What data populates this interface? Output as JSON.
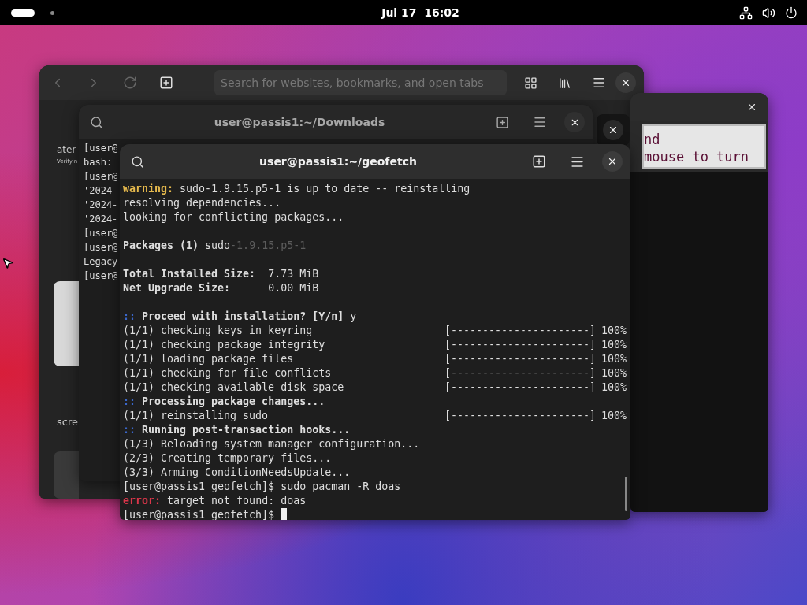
{
  "top_bar": {
    "clock": "Jul 17  16:02"
  },
  "browser": {
    "search": {
      "placeholder": "Search for websites, bookmarks, and open tabs"
    },
    "sidebar_texts": [
      "ater",
      "Verifyin",
      "scre"
    ]
  },
  "game_window": {
    "lines": [
      "nd",
      "mouse to turn"
    ]
  },
  "back_terminal": {
    "title": "user@passis1:~/Downloads",
    "lines": [
      "[user@",
      "bash:",
      "[user@",
      "'2024-",
      "'2024-",
      "'2024-",
      "[user@",
      "[user@",
      "Legacy",
      "[user@"
    ]
  },
  "front_terminal": {
    "title": "user@passis1:~/geofetch",
    "lines": [
      {
        "kind": "text",
        "segments": [
          {
            "text": "warning:",
            "kind": "warning"
          },
          {
            "text": " sudo-1.9.15.p5-1 is up to date -- reinstalling",
            "kind": "plain"
          }
        ]
      },
      {
        "kind": "text",
        "segments": [
          {
            "text": "resolving dependencies...",
            "kind": "plain"
          }
        ]
      },
      {
        "kind": "text",
        "segments": [
          {
            "text": "looking for conflicting packages...",
            "kind": "plain"
          }
        ]
      },
      {
        "kind": "blank"
      },
      {
        "kind": "text",
        "segments": [
          {
            "text": "Packages (1)",
            "kind": "bold"
          },
          {
            "text": " sudo",
            "kind": "plain"
          },
          {
            "text": "-1.9.15.p5-1",
            "kind": "dim"
          }
        ]
      },
      {
        "kind": "blank"
      },
      {
        "kind": "text",
        "segments": [
          {
            "text": "Total Installed Size:",
            "kind": "bold"
          },
          {
            "text": "  7.73 MiB",
            "kind": "plain"
          }
        ]
      },
      {
        "kind": "text",
        "segments": [
          {
            "text": "Net Upgrade Size:",
            "kind": "bold"
          },
          {
            "text": "      0.00 MiB",
            "kind": "plain"
          }
        ]
      },
      {
        "kind": "blank"
      },
      {
        "kind": "text",
        "segments": [
          {
            "text": "::",
            "kind": "marker"
          },
          {
            "text": " Proceed with installation? [Y/n]",
            "kind": "bold"
          },
          {
            "text": " y",
            "kind": "plain"
          }
        ]
      },
      {
        "kind": "progress",
        "text": "(1/1) checking keys in keyring",
        "bar": "[----------------------]",
        "percent": "100%"
      },
      {
        "kind": "progress",
        "text": "(1/1) checking package integrity",
        "bar": "[----------------------]",
        "percent": "100%"
      },
      {
        "kind": "progress",
        "text": "(1/1) loading package files",
        "bar": "[----------------------]",
        "percent": "100%"
      },
      {
        "kind": "progress",
        "text": "(1/1) checking for file conflicts",
        "bar": "[----------------------]",
        "percent": "100%"
      },
      {
        "kind": "progress",
        "text": "(1/1) checking available disk space",
        "bar": "[----------------------]",
        "percent": "100%"
      },
      {
        "kind": "text",
        "segments": [
          {
            "text": "::",
            "kind": "marker"
          },
          {
            "text": " Processing package changes...",
            "kind": "bold"
          }
        ]
      },
      {
        "kind": "progress",
        "text": "(1/1) reinstalling sudo",
        "bar": "[----------------------]",
        "percent": "100%"
      },
      {
        "kind": "text",
        "segments": [
          {
            "text": "::",
            "kind": "marker"
          },
          {
            "text": " Running post-transaction hooks...",
            "kind": "bold"
          }
        ]
      },
      {
        "kind": "text",
        "segments": [
          {
            "text": "(1/3) Reloading system manager configuration...",
            "kind": "plain"
          }
        ]
      },
      {
        "kind": "text",
        "segments": [
          {
            "text": "(2/3) Creating temporary files...",
            "kind": "plain"
          }
        ]
      },
      {
        "kind": "text",
        "segments": [
          {
            "text": "(3/3) Arming ConditionNeedsUpdate...",
            "kind": "plain"
          }
        ]
      },
      {
        "kind": "text",
        "segments": [
          {
            "text": "[user@passis1 geofetch]$ sudo pacman -R doas",
            "kind": "plain"
          }
        ]
      },
      {
        "kind": "text",
        "segments": [
          {
            "text": "error:",
            "kind": "error"
          },
          {
            "text": " target not found: doas",
            "kind": "plain"
          }
        ]
      },
      {
        "kind": "prompt",
        "text": "[user@passis1 geofetch]$ "
      }
    ]
  }
}
